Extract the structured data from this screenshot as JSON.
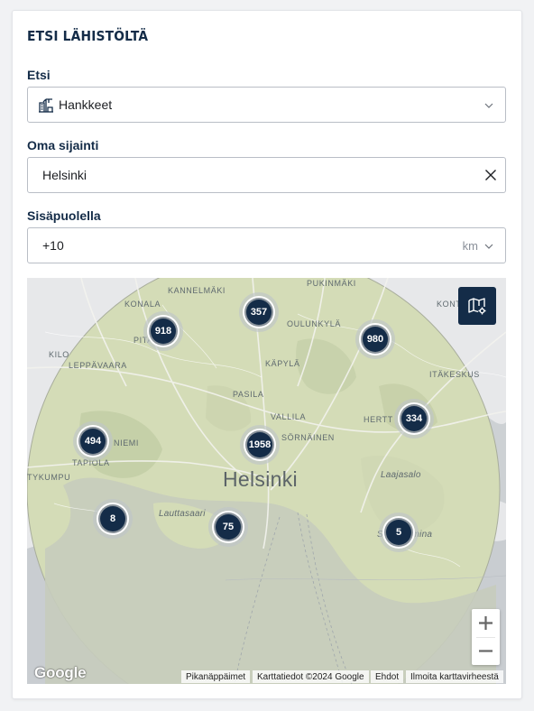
{
  "title": "ETSI LÄHISTÖLTÄ",
  "search": {
    "label": "Etsi",
    "value": "Hankkeet"
  },
  "location": {
    "label": "Oma sijainti",
    "value": "Helsinki"
  },
  "radius": {
    "label": "Sisäpuolella",
    "value": "+10",
    "unit": "km"
  },
  "map": {
    "city_label": "Helsinki",
    "places": {
      "kannelmaki": "KANNELMÄKI",
      "pukinmaki": "PUKINMÄKI",
      "konala": "KONALA",
      "oulunkyla": "OULUNKYLÄ",
      "kontula": "KONT",
      "pitajanmaki": "PITAJ",
      "kilo": "KILO",
      "leppavaara": "LEPPÄVAARA",
      "kapyla": "KÄPYLÄ",
      "itakeskus": "ITÄKESKUS",
      "pasila": "PASILA",
      "vallila": "VALLILA",
      "herttoniemi": "HERTT",
      "lauttasaari": "Lauttasaari",
      "sornainen": "SÖRNÄINEN",
      "laajasalo": "Laajasalo",
      "tapiola": "TAPIOLA",
      "niemi": "NIEMI",
      "tykkumpu": "TYKUMPU",
      "santahamina": "Santahamina"
    },
    "clusters": [
      {
        "id": "c357",
        "count": "357"
      },
      {
        "id": "c918",
        "count": "918"
      },
      {
        "id": "c980",
        "count": "980"
      },
      {
        "id": "c334",
        "count": "334"
      },
      {
        "id": "c494",
        "count": "494"
      },
      {
        "id": "c1958",
        "count": "1958"
      },
      {
        "id": "c8",
        "count": "8"
      },
      {
        "id": "c75",
        "count": "75"
      },
      {
        "id": "c5",
        "count": "5"
      }
    ],
    "google_logo": "Google",
    "attribution": {
      "shortcuts": "Pikanäppäimet",
      "data": "Karttatiedot ©2024 Google",
      "terms": "Ehdot",
      "report": "Ilmoita karttavirheestä"
    }
  },
  "colors": {
    "primary": "#142c48",
    "circle_fill": "#d3dcb6",
    "land": "#e6e8ea",
    "water": "#c8ccd0"
  },
  "icons": [
    "building-crane-icon",
    "chevron-down-icon",
    "close-icon",
    "map-layers-icon",
    "zoom-in-icon",
    "zoom-out-icon"
  ]
}
